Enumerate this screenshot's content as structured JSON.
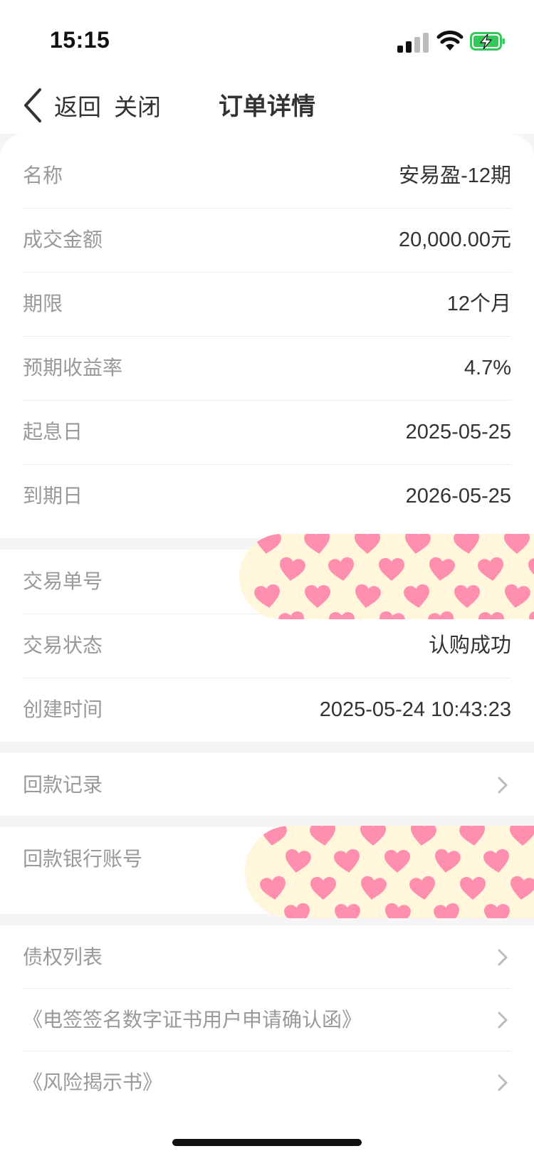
{
  "status_bar": {
    "time": "15:15"
  },
  "nav": {
    "back_label": "返回",
    "close_label": "关闭",
    "title": "订单详情"
  },
  "order_info": [
    {
      "label": "名称",
      "value": "安易盈-12期"
    },
    {
      "label": "成交金额",
      "value": "20,000.00元"
    },
    {
      "label": "期限",
      "value": "12个月"
    },
    {
      "label": "预期收益率",
      "value": "4.7%"
    },
    {
      "label": "起息日",
      "value": "2025-05-25"
    },
    {
      "label": "到期日",
      "value": "2026-05-25"
    }
  ],
  "transaction": {
    "order_no_label": "交易单号",
    "status_label": "交易状态",
    "status_value": "认购成功",
    "created_label": "创建时间",
    "created_value": "2025-05-24 10:43:23"
  },
  "repayment_record_label": "回款记录",
  "repayment_account_label": "回款银行账号",
  "documents": [
    {
      "label": "债权列表"
    },
    {
      "label": "《电签签名数字证书用户申请确认函》"
    },
    {
      "label": "《风险揭示书》"
    }
  ],
  "colors": {
    "label": "#999999",
    "value": "#333333",
    "sticker_bg": "#fff6dc",
    "heart": "#ff8fae"
  }
}
